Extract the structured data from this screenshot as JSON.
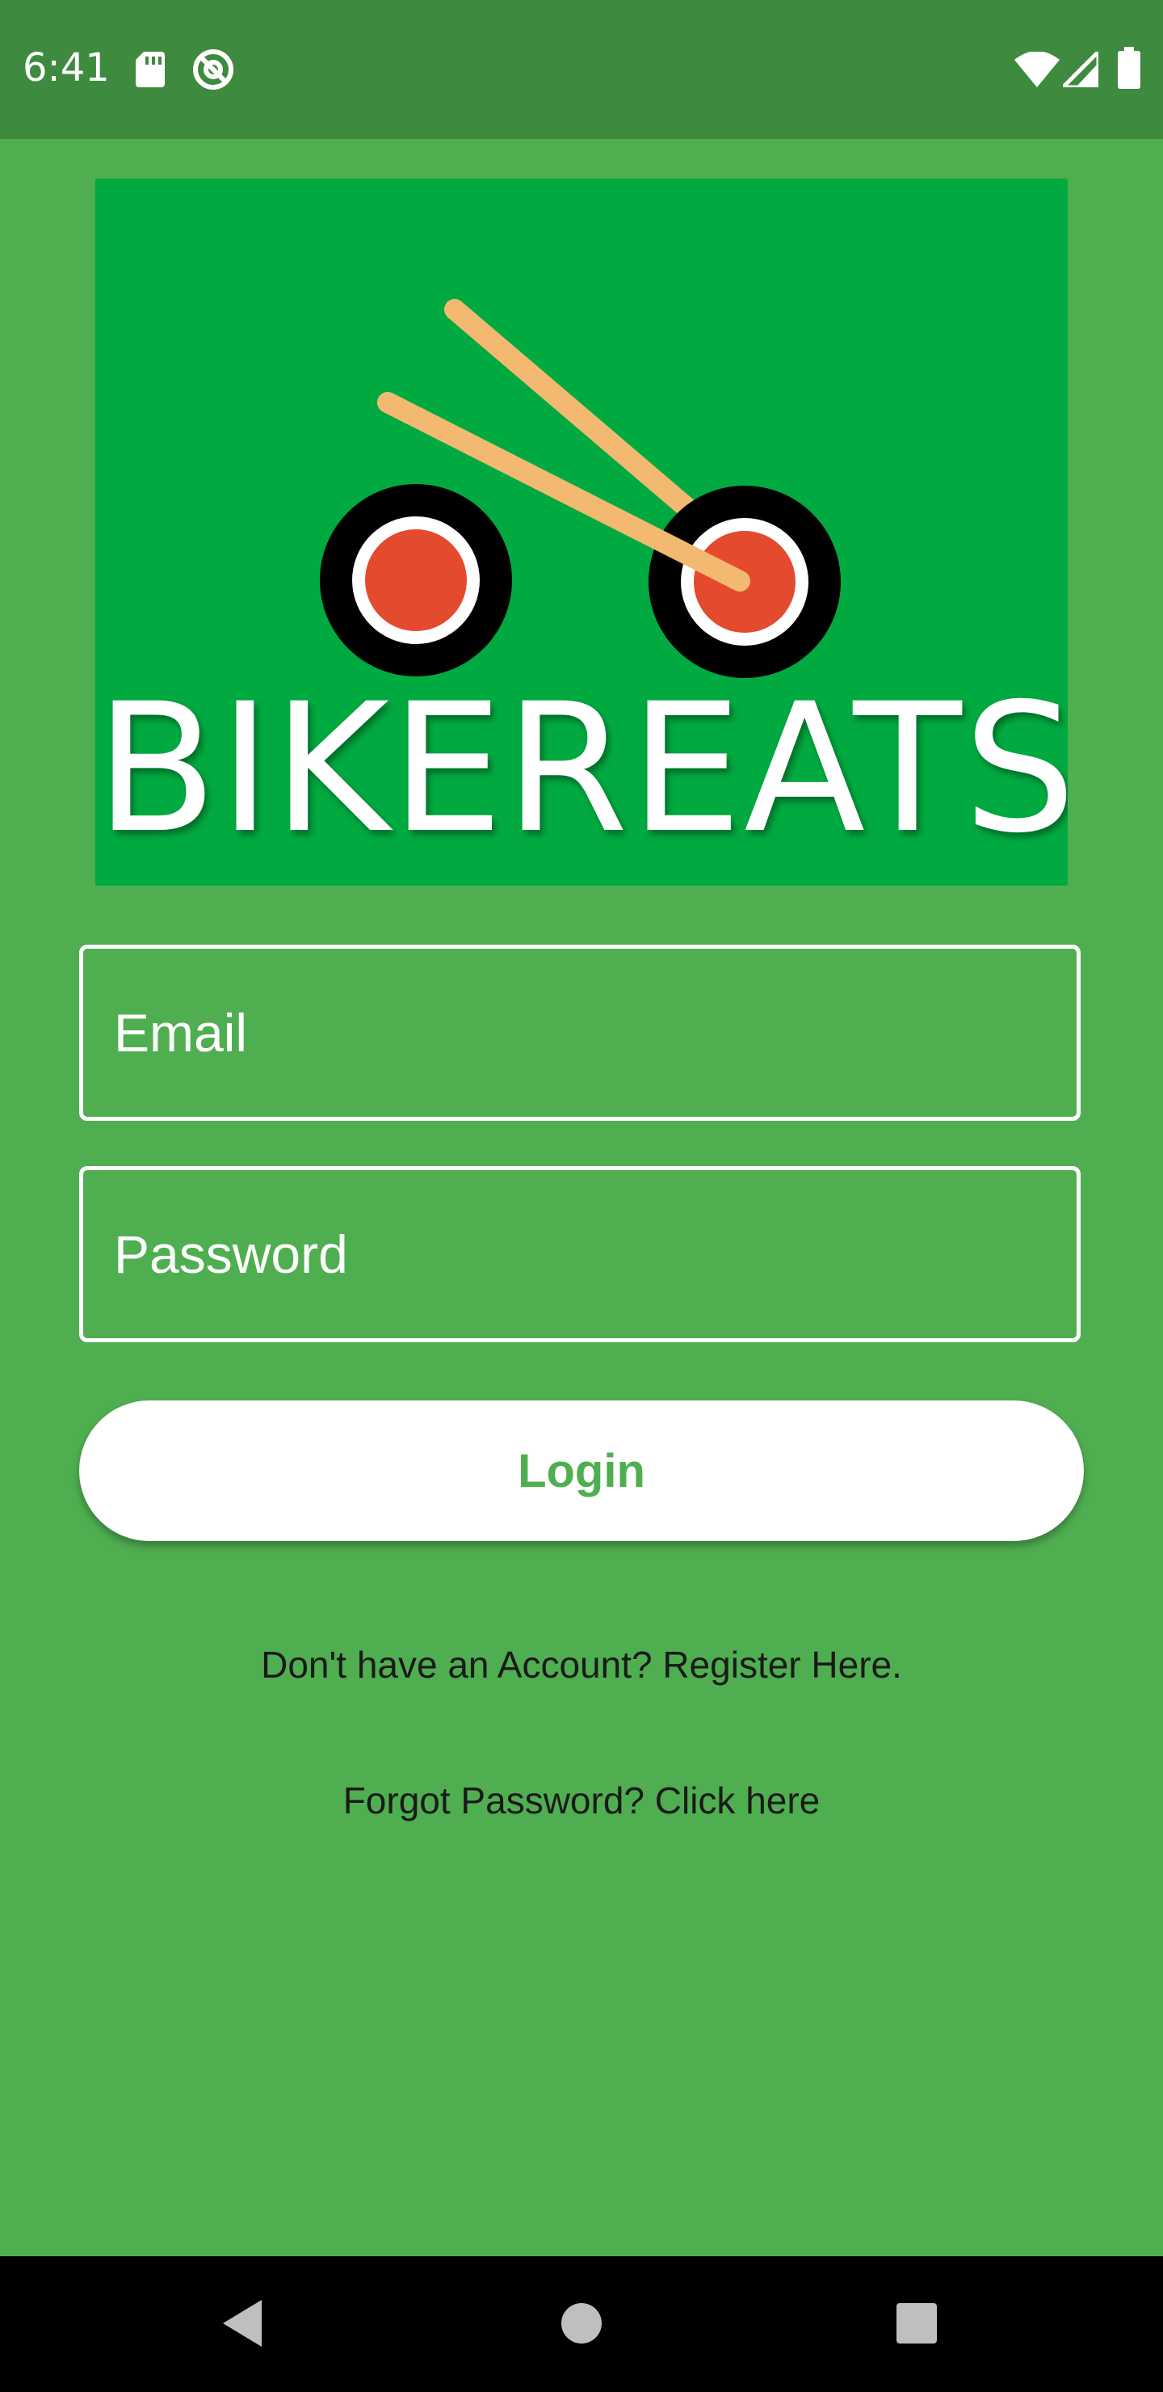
{
  "status_bar": {
    "time": "6:41",
    "left_icons": [
      "sd-card-icon",
      "do-not-disturb-icon"
    ],
    "right_icons": [
      "wifi-icon",
      "cell-signal-icon",
      "battery-icon"
    ]
  },
  "logo": {
    "text": "BIKEREATS",
    "background_color": "#00AA40"
  },
  "form": {
    "email_placeholder": "Email",
    "password_placeholder": "Password",
    "login_label": "Login"
  },
  "links": {
    "register": "Don't have an Account? Register Here.",
    "forgot_password": "Forgot Password? Click here"
  },
  "nav_bar": {
    "buttons": [
      "back-icon",
      "home-icon",
      "recents-icon"
    ]
  },
  "colors": {
    "background": "#4FAF50",
    "status_bar": "#3E8A3F",
    "button_text": "#4FAF50"
  }
}
